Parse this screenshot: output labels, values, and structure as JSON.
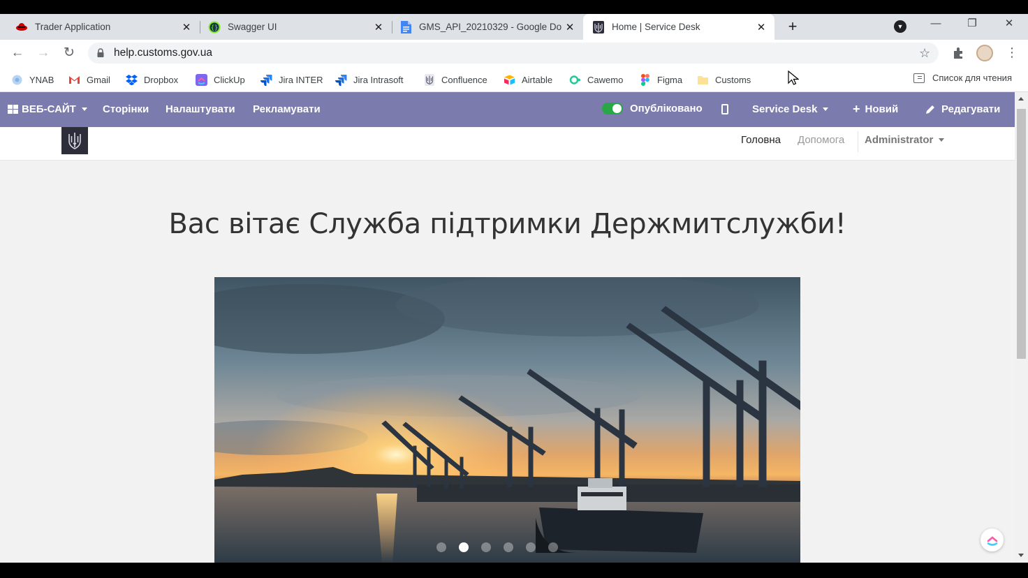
{
  "browser": {
    "tabs": [
      {
        "title": "Trader Application",
        "icon": "redhat-icon"
      },
      {
        "title": "Swagger UI",
        "icon": "swagger-icon"
      },
      {
        "title": "GMS_API_20210329 - Google Do",
        "icon": "google-docs-icon"
      },
      {
        "title": "Home | Service Desk",
        "icon": "trident-icon",
        "active": true
      }
    ],
    "url": "help.customs.gov.ua",
    "bookmarks": [
      {
        "label": "YNAB",
        "icon": "ynab-icon"
      },
      {
        "label": "Gmail",
        "icon": "gmail-icon"
      },
      {
        "label": "Dropbox",
        "icon": "dropbox-icon"
      },
      {
        "label": "ClickUp",
        "icon": "clickup-icon"
      },
      {
        "label": "Jira INTER",
        "icon": "jira-icon"
      },
      {
        "label": "Jira Intrasoft",
        "icon": "jira-icon"
      },
      {
        "label": "Confluence",
        "icon": "trident-icon"
      },
      {
        "label": "Airtable",
        "icon": "airtable-icon"
      },
      {
        "label": "Cawemo",
        "icon": "cawemo-icon"
      },
      {
        "label": "Figma",
        "icon": "figma-icon"
      },
      {
        "label": "Customs",
        "icon": "folder-icon"
      }
    ],
    "reading_list": "Список для чтения"
  },
  "editor_bar": {
    "website_menu": "ВЕБ-САЙТ",
    "pages": "Сторінки",
    "customize": "Налаштувати",
    "promote": "Рекламувати",
    "published": "Опубліковано",
    "published_on": true,
    "service_desk": "Service Desk",
    "new": "Новий",
    "edit": "Редагувати",
    "color": "#7c7bad"
  },
  "site_nav": {
    "home": "Головна",
    "help": "Допомога",
    "user": "Administrator"
  },
  "hero": {
    "title": "Вас вітає Служба підтримки Держмитслужби!",
    "carousel_slides": 6,
    "active_slide": 2
  }
}
